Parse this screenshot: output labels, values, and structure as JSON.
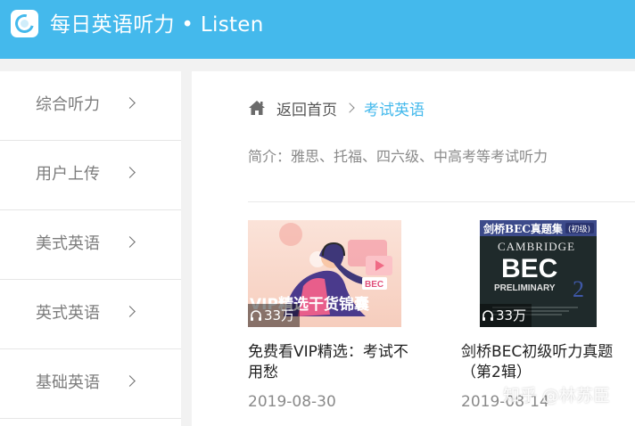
{
  "header": {
    "title": "每日英语听力 • Listen",
    "color": "#44b9ec"
  },
  "sidebar": {
    "items": [
      {
        "label": "综合听力"
      },
      {
        "label": "用户上传"
      },
      {
        "label": "美式英语"
      },
      {
        "label": "英式英语"
      },
      {
        "label": "基础英语"
      }
    ]
  },
  "breadcrumb": {
    "home": "返回首页",
    "current": "考试英语"
  },
  "intro": "简介：雅思、托福、四六级、中高考等考试听力",
  "cards": [
    {
      "title": "免费看VIP精选：考试不用愁",
      "plays": "33万",
      "date": "2019-08-30",
      "cover_text": "VIP精选干货锦囊",
      "cover_tag": "BEC"
    },
    {
      "title": "剑桥BEC初级听力真题（第2辑）",
      "plays": "33万",
      "date": "2019-08-14",
      "cover_top": "剑桥BEC真题集",
      "cover_edition": "(初级)",
      "cover_brand": "CAMBRIDGE",
      "cover_big": "BEC",
      "cover_level": "PRELIMINARY",
      "cover_num": "2"
    }
  ],
  "watermark": "知乎 @林苏臣"
}
